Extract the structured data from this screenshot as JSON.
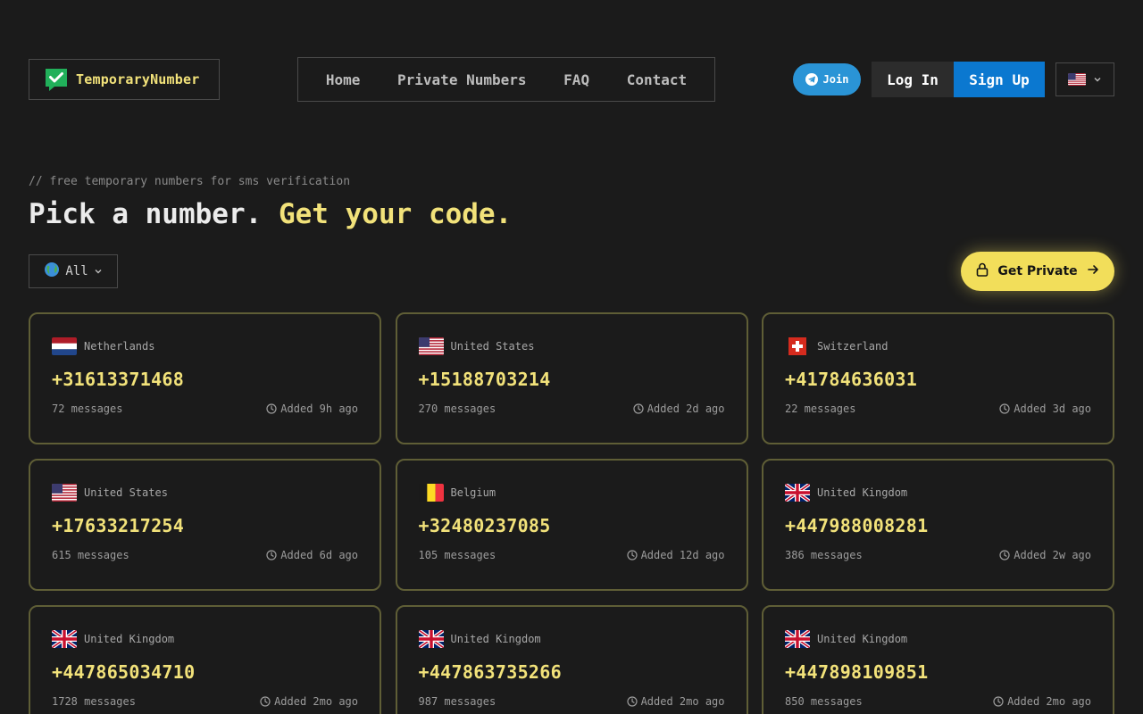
{
  "header": {
    "logo_text": "TemporaryNumber",
    "nav": [
      {
        "label": "Home"
      },
      {
        "label": "Private Numbers"
      },
      {
        "label": "FAQ"
      },
      {
        "label": "Contact"
      }
    ],
    "join_label": "Join",
    "login_label": "Log In",
    "signup_label": "Sign Up",
    "language_flag": "us"
  },
  "hero": {
    "tagline": "// free temporary numbers for sms verification",
    "headline_part1": "Pick a number.",
    "headline_part2": "Get your code."
  },
  "filter": {
    "label": "All"
  },
  "get_private_label": "Get Private",
  "colors": {
    "accent": "#f2e27a",
    "telegram": "#2a94d6",
    "signup": "#0b78d0",
    "card_border": "#5f5e36"
  },
  "numbers": [
    {
      "country": "Netherlands",
      "flag": "nl",
      "phone": "+31613371468",
      "messages": "72 messages",
      "added": "Added 9h ago"
    },
    {
      "country": "United States",
      "flag": "us",
      "phone": "+15188703214",
      "messages": "270 messages",
      "added": "Added 2d ago"
    },
    {
      "country": "Switzerland",
      "flag": "ch",
      "phone": "+41784636031",
      "messages": "22 messages",
      "added": "Added 3d ago"
    },
    {
      "country": "United States",
      "flag": "us",
      "phone": "+17633217254",
      "messages": "615 messages",
      "added": "Added 6d ago"
    },
    {
      "country": "Belgium",
      "flag": "be",
      "phone": "+32480237085",
      "messages": "105 messages",
      "added": "Added 12d ago"
    },
    {
      "country": "United Kingdom",
      "flag": "gb",
      "phone": "+447988008281",
      "messages": "386 messages",
      "added": "Added 2w ago"
    },
    {
      "country": "United Kingdom",
      "flag": "gb",
      "phone": "+447865034710",
      "messages": "1728 messages",
      "added": "Added 2mo ago"
    },
    {
      "country": "United Kingdom",
      "flag": "gb",
      "phone": "+447863735266",
      "messages": "987 messages",
      "added": "Added 2mo ago"
    },
    {
      "country": "United Kingdom",
      "flag": "gb",
      "phone": "+447898109851",
      "messages": "850 messages",
      "added": "Added 2mo ago"
    }
  ]
}
